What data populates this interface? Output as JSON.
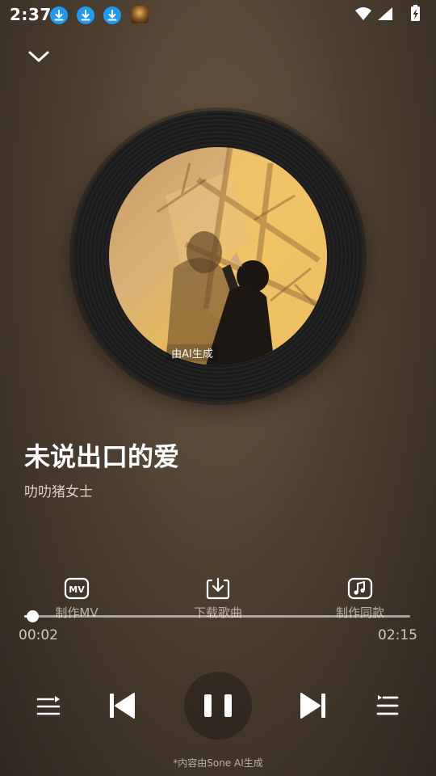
{
  "status_bar": {
    "time": "2:37",
    "notification_icons": [
      "download-icon",
      "download-icon",
      "download-icon",
      "app-thumbnail"
    ],
    "system_icons": [
      "wifi-icon",
      "signal-icon",
      "battery-charging-icon"
    ]
  },
  "header": {
    "collapse_icon": "chevron-down-icon"
  },
  "cover": {
    "ai_badge": "由AI生成"
  },
  "song": {
    "title": "未说出口的爱",
    "artist": "叻叻猪女士"
  },
  "actions": [
    {
      "icon": "mv-icon",
      "label": "制作MV"
    },
    {
      "icon": "download-icon",
      "label": "下载歌曲"
    },
    {
      "icon": "music-note-icon",
      "label": "制作同款"
    }
  ],
  "progress": {
    "current": "00:02",
    "total": "02:15",
    "fraction": 0.015
  },
  "controls": {
    "left": "playlist-icon",
    "prev": "skip-previous-icon",
    "play": "pause-icon",
    "next": "skip-next-icon",
    "right": "queue-icon"
  },
  "footnote": "*内容由Sone AI生成",
  "colors": {
    "notification_badge": "#1e9bf0",
    "background_base": "#4d3f30"
  }
}
